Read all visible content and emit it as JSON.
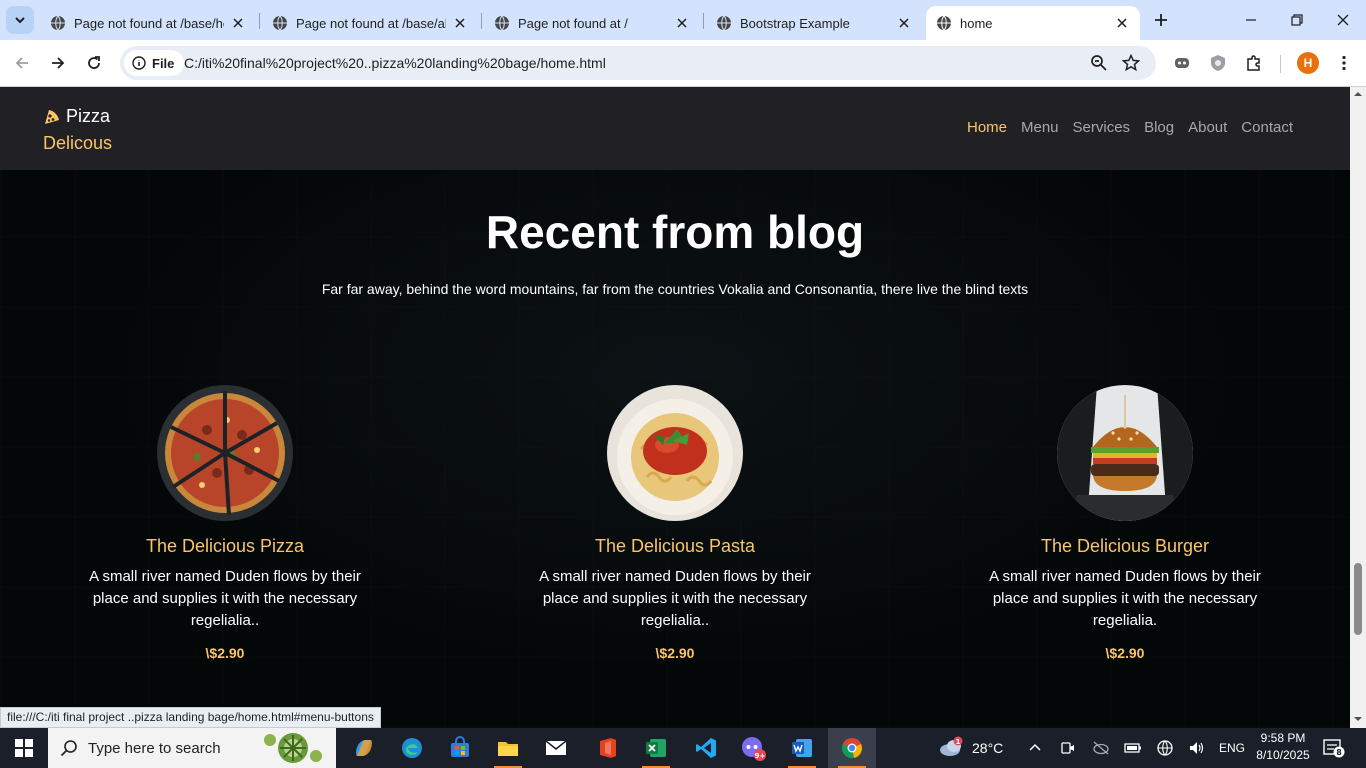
{
  "browser": {
    "tabs": [
      {
        "label": "Page not found at /base/hor"
      },
      {
        "label": "Page not found at /base/abo"
      },
      {
        "label": "Page not found at /"
      },
      {
        "label": "Bootstrap Example"
      },
      {
        "label": "home"
      }
    ],
    "address_chip": "File",
    "url": "C:/iti%20final%20project%20..pizza%20landing%20bage/home.html",
    "profile_initial": "H",
    "status_link": "file:///C:/iti final project ..pizza landing bage/home.html#menu-buttons"
  },
  "site": {
    "brand_line1": "Pizza",
    "brand_line2": "Delicous",
    "menu": [
      "Home",
      "Menu",
      "Services",
      "Blog",
      "About",
      "Contact"
    ],
    "active_menu": "Home",
    "accent_color": "#fac564",
    "blog": {
      "title": "Recent from blog",
      "subtitle": "Far far away, behind the word mountains, far from the countries Vokalia and Consonantia, there live the blind texts",
      "posts": [
        {
          "title": "The Delicious Pizza",
          "text": "A small river named Duden flows by their place and supplies it with the necessary regelialia..",
          "price": "\\$2.90",
          "image": "pizza"
        },
        {
          "title": "The Delicious Pasta",
          "text": "A small river named Duden flows by their place and supplies it with the necessary regelialia..",
          "price": "\\$2.90",
          "image": "pasta"
        },
        {
          "title": "The Delicious Burger",
          "text": "A small river named Duden flows by their place and supplies it with the necessary regelialia.",
          "price": "\\$2.90",
          "image": "burger"
        }
      ]
    }
  },
  "taskbar": {
    "search_placeholder": "Type here to search",
    "weather": "28°C",
    "weather_badge": "1",
    "language": "ENG",
    "time": "9:58 PM",
    "date": "8/10/2025",
    "notification_count": "8",
    "discord_badge": "9+"
  }
}
